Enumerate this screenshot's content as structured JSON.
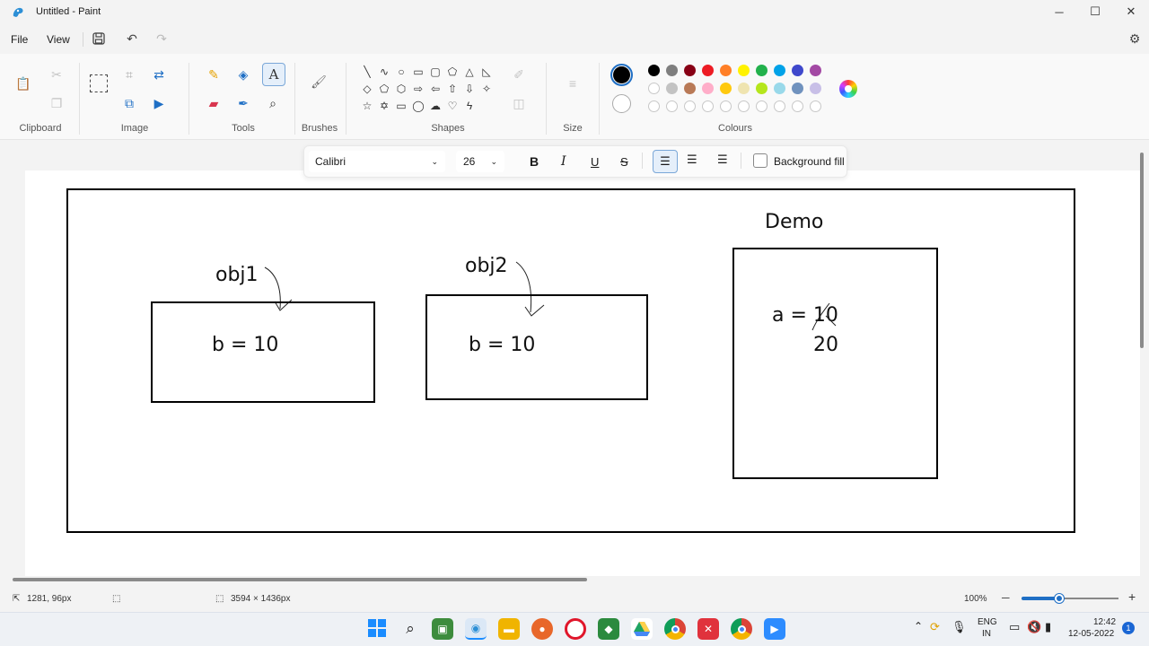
{
  "window": {
    "title": "Untitled - Paint",
    "minimize": "─",
    "maximize": "☐",
    "close": "✕"
  },
  "menu": {
    "file": "File",
    "view": "View"
  },
  "ribbon": {
    "groups": {
      "clipboard": "Clipboard",
      "image": "Image",
      "tools": "Tools",
      "brushes": "Brushes",
      "shapes": "Shapes",
      "size": "Size",
      "colours": "Colours"
    },
    "colors_row1": [
      "#000000",
      "#7f7f7f",
      "#880015",
      "#ed1c24",
      "#ff7f27",
      "#fff200",
      "#22b14c",
      "#00a2e8",
      "#3f48cc",
      "#a349a4"
    ],
    "colors_row2": [
      "#ffffff",
      "#c3c3c3",
      "#b97a57",
      "#ffaec9",
      "#ffc90e",
      "#efe4b0",
      "#b5e61d",
      "#99d9ea",
      "#7092be",
      "#c8bfe7"
    ],
    "colors_row3_empty_count": 10,
    "primary_color": "#000000",
    "secondary_color": "#ffffff"
  },
  "text_toolbar": {
    "font": "Calibri",
    "size": "26",
    "bold": "B",
    "italic": "I",
    "underline": "U",
    "strike": "S",
    "background_fill": "Background fill"
  },
  "canvas": {
    "obj1_label": "obj1",
    "obj2_label": "obj2",
    "obj1_value": "b = 10",
    "obj2_value": "b = 10",
    "demo_label": "Demo",
    "demo_a": "a = 10",
    "demo_new": "20"
  },
  "status": {
    "cursor": "1281, 96px",
    "canvas_size": "3594 × 1436px",
    "zoom": "100%"
  },
  "tray": {
    "lang1": "ENG",
    "lang2": "IN",
    "time": "12:42",
    "date": "12-05-2022",
    "notifications": "1"
  }
}
